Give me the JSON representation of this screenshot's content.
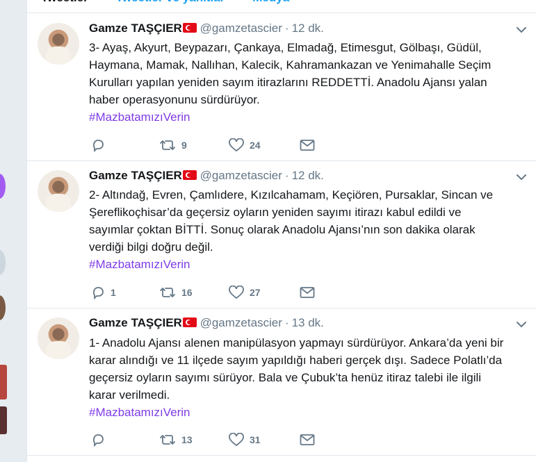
{
  "tabs": [
    {
      "label": "Tweetler"
    },
    {
      "label": "Tweetler ve yanıtlar"
    },
    {
      "label": "Medya"
    }
  ],
  "tweets": [
    {
      "name": "Gamze TAŞÇIER",
      "handle": "@gamzetascier",
      "time": "12 dk.",
      "text": "3- Ayaş, Akyurt, Beypazarı, Çankaya, Elmadağ, Etimesgut, Gölbaşı, Güdül, Haymana, Mamak, Nallıhan, Kalecik, Kahramankazan ve Yenimahalle Seçim Kurulları yapılan yeniden sayım itirazlarını REDDETTİ. Anadolu Ajansı yalan haber operasyonunu sürdürüyor.",
      "hashtag": "#MazbatamızıVerin",
      "replies": "",
      "retweets": "9",
      "likes": "24"
    },
    {
      "name": "Gamze TAŞÇIER",
      "handle": "@gamzetascier",
      "time": "12 dk.",
      "text": "2- Altındağ, Evren, Çamlıdere, Kızılcahamam, Keçiören, Pursaklar, Sincan ve Şereflikoçhisar’da geçersiz oyların yeniden sayımı itirazı kabul edildi ve sayımlar çoktan BİTTİ. Sonuç olarak Anadolu Ajansı’nın son dakika olarak verdiği bilgi doğru değil.",
      "hashtag": "#MazbatamızıVerin",
      "replies": "1",
      "retweets": "16",
      "likes": "27"
    },
    {
      "name": "Gamze TAŞÇIER",
      "handle": "@gamzetascier",
      "time": "13 dk.",
      "text": "1- Anadolu Ajansı alenen manipülasyon yapmayı sürdürüyor. Ankara’da yeni bir karar alındığı ve 11 ilçede sayım yapıldığı haberi gerçek dışı. Sadece Polatlı’da geçersiz oyların sayımı sürüyor. Bala ve Çubuk’ta henüz itiraz talebi ile ilgili karar verilmedi.",
      "hashtag": "#MazbatamızıVerin",
      "replies": "",
      "retweets": "13",
      "likes": "31"
    }
  ],
  "colors": {
    "hashtag": "#7e3be6",
    "muted": "#657786",
    "tab_link": "#1da1f2"
  }
}
